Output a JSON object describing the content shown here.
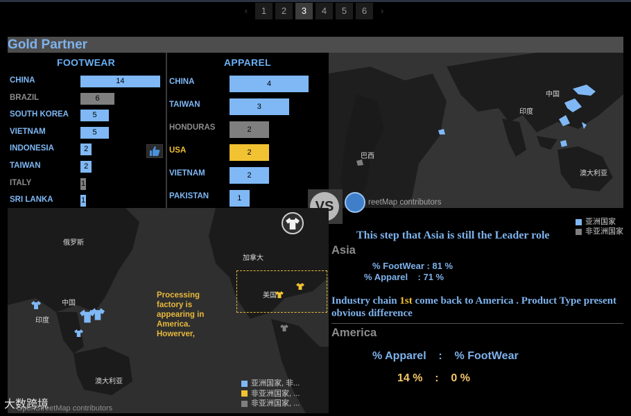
{
  "pagination": {
    "prev": "‹",
    "next": "›",
    "pages": [
      "1",
      "2",
      "3",
      "4",
      "5",
      "6"
    ],
    "active": "3"
  },
  "header": {
    "title": "Gold Partner"
  },
  "colors": {
    "blue": "#7fb8f5",
    "gray": "#7f7f7f",
    "yellow": "#f1c232",
    "text_blue": "#7eb2ec"
  },
  "footwear": {
    "title": "FOOTWEAR",
    "rows": [
      {
        "label": "CHINA",
        "value": 14,
        "color": "blue"
      },
      {
        "label": "BRAZIL",
        "value": 6,
        "color": "gray"
      },
      {
        "label": "SOUTH KOREA",
        "value": 5,
        "color": "blue"
      },
      {
        "label": "VIETNAM",
        "value": 5,
        "color": "blue"
      },
      {
        "label": "INDONESIA",
        "value": 2,
        "color": "blue"
      },
      {
        "label": "TAIWAN",
        "value": 2,
        "color": "blue"
      },
      {
        "label": "ITALY",
        "value": 1,
        "color": "gray"
      },
      {
        "label": "SRI LANKA",
        "value": 1,
        "color": "blue"
      }
    ]
  },
  "apparel": {
    "title": "APPAREL",
    "rows": [
      {
        "label": "CHINA",
        "value": 4,
        "color": "blue"
      },
      {
        "label": "TAIWAN",
        "value": 3,
        "color": "blue"
      },
      {
        "label": "HONDURAS",
        "value": 2,
        "color": "gray"
      },
      {
        "label": "USA",
        "value": 2,
        "color": "yellow"
      },
      {
        "label": "VIETNAM",
        "value": 2,
        "color": "blue"
      },
      {
        "label": "PAKISTAN",
        "value": 1,
        "color": "blue"
      }
    ]
  },
  "vs_label": "VS",
  "map_top": {
    "labels": {
      "china": "中国",
      "india": "印度",
      "brazil": "巴西",
      "australia": "澳大利亚"
    },
    "credit": "reetMap contributors"
  },
  "map_bottom": {
    "labels": {
      "russia": "俄罗斯",
      "china": "中国",
      "india": "印度",
      "canada": "加拿大",
      "usa": "美国",
      "australia": "澳大利亚"
    },
    "note": "Processing factory is appearing in America. Howerver,",
    "legend": [
      {
        "label": "亚洲国家, 非...",
        "color": "blue"
      },
      {
        "label": "非亚洲国家, ...",
        "color": "yellow"
      },
      {
        "label": "非亚洲国家, ...",
        "color": "gray"
      }
    ],
    "brand": "大数跨境",
    "credit": "OpenStreetMap contributors"
  },
  "legend_top": [
    {
      "label": "亚洲国家",
      "color": "blue"
    },
    {
      "label": "非亚洲国家",
      "color": "gray"
    }
  ],
  "analysis": {
    "headline": "This step that Asia is still the Leader role",
    "asia": {
      "title": "Asia",
      "footwear_line": "% FootWear : 81 %",
      "apparel_line": "% Apparel    : 71 %"
    },
    "para_before": "Industry chain ",
    "para_highlight": "1st",
    "para_after": " come back to America . Product Type  present obvious difference",
    "america": {
      "title": "America",
      "labels_line": "% Apparel    :    % FootWear",
      "values_line": "14 %    :    0 %"
    }
  }
}
